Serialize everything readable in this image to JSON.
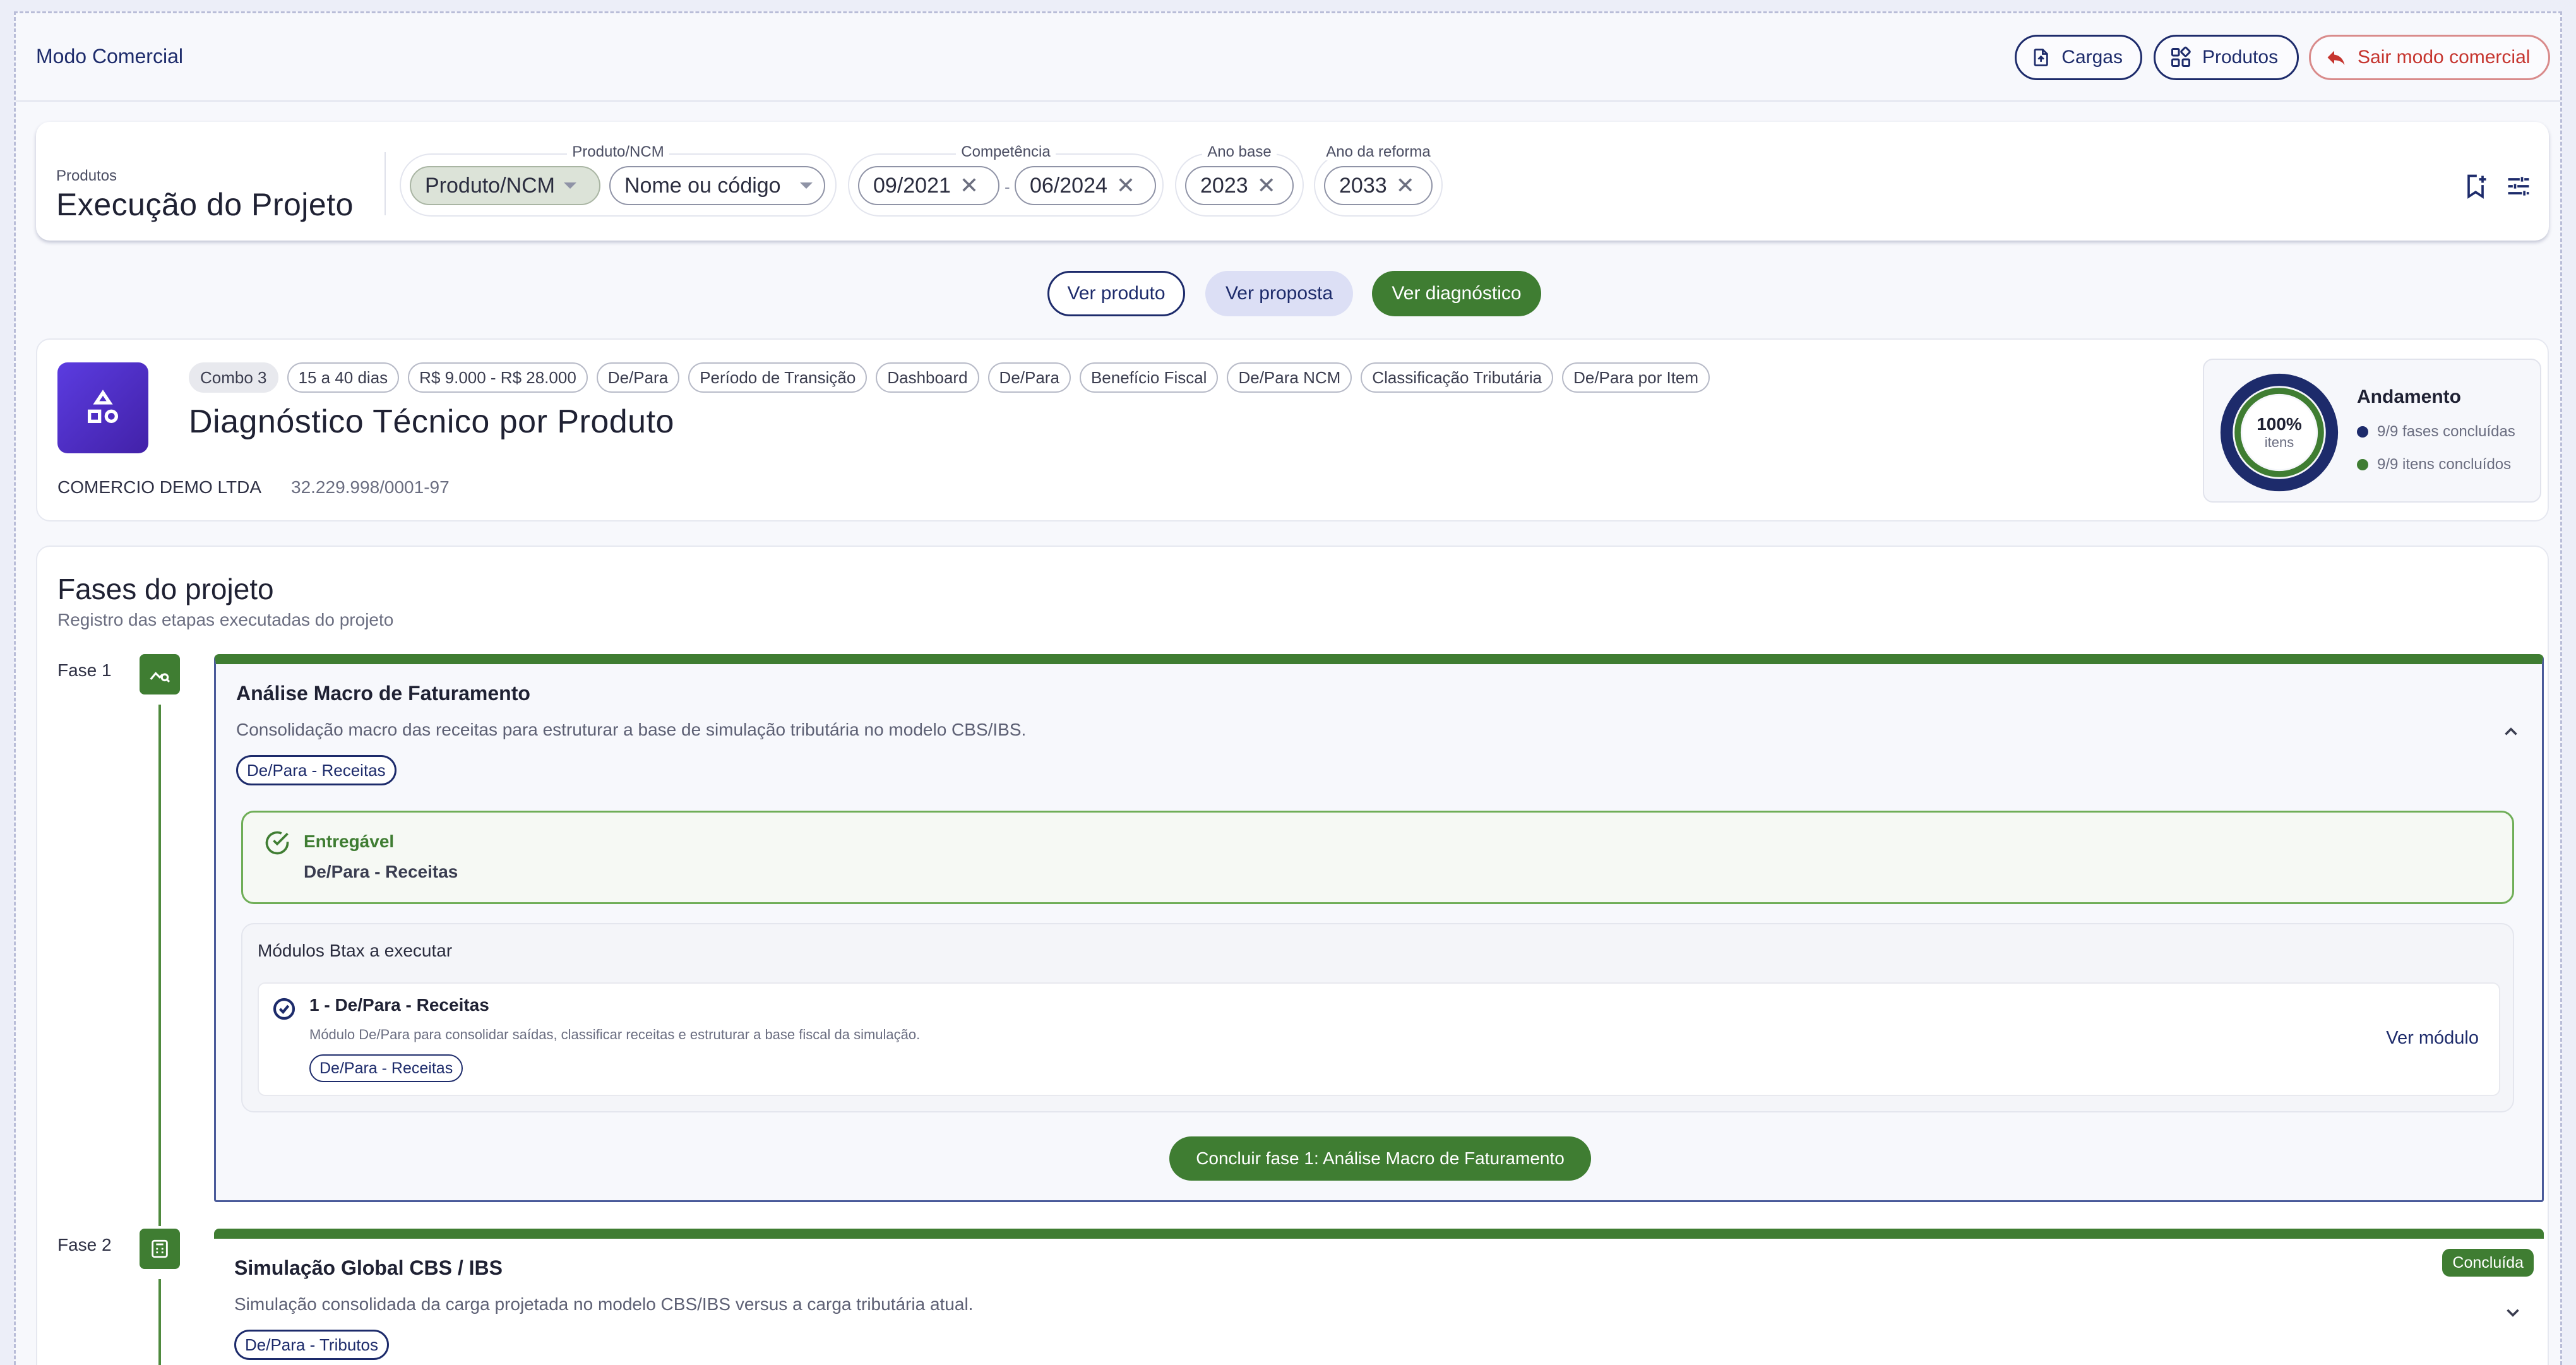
{
  "app": {
    "title": "Modo Comercial"
  },
  "topbar": {
    "cargas_label": "Cargas",
    "produtos_label": "Produtos",
    "exit_label": "Sair modo comercial"
  },
  "filters": {
    "breadcrumb": "Produtos",
    "title": "Execução do Projeto",
    "produto_group_label": "Produto/NCM",
    "produto_select": "Produto/NCM",
    "search_placeholder": "Nome ou código",
    "competencia_label": "Competência",
    "competencia_start": "09/2021",
    "competencia_end": "06/2024",
    "ano_base_label": "Ano base",
    "ano_base": "2023",
    "ano_reforma_label": "Ano da reforma",
    "ano_reforma": "2033",
    "clear_symbol": "✕",
    "separator": "-"
  },
  "view_buttons": {
    "produto": "Ver produto",
    "proposta": "Ver proposta",
    "diagnostico": "Ver diagnóstico"
  },
  "product": {
    "tags": [
      "Combo 3",
      "15 a 40 dias",
      "R$ 9.000 - R$ 28.000",
      "De/Para",
      "Período de Transição",
      "Dashboard",
      "De/Para",
      "Benefício Fiscal",
      "De/Para NCM",
      "Classificação Tributária",
      "De/Para por Item"
    ],
    "title": "Diagnóstico Técnico por Produto",
    "company": "COMERCIO DEMO LTDA",
    "cnpj": "32.229.998/0001-97",
    "progress": {
      "percent_label": "100%",
      "percent_value": 100,
      "unit": "itens",
      "title": "Andamento",
      "phases_done": "9/9 fases concluídas",
      "items_done": "9/9 itens concluídos",
      "phases_color": "#1d2b6b",
      "items_color": "#3f7d32"
    }
  },
  "phases": {
    "title": "Fases do projeto",
    "subtitle": "Registro das etapas executadas do projeto",
    "list": [
      {
        "label": "Fase 1",
        "title": "Análise Macro de Faturamento",
        "description": "Consolidação macro das receitas para estruturar a base de simulação tributária no modelo CBS/IBS.",
        "tag": "De/Para - Receitas",
        "deliverable_label": "Entregável",
        "deliverable_value": "De/Para - Receitas",
        "modules_title": "Módulos Btax a executar",
        "module": {
          "title": "1 - De/Para - Receitas",
          "description": "Módulo De/Para para consolidar saídas, classificar receitas e estruturar a base fiscal da simulação.",
          "tag": "De/Para - Receitas",
          "link": "Ver módulo"
        },
        "conclude_label": "Concluir fase 1: Análise Macro de Faturamento"
      },
      {
        "label": "Fase 2",
        "title": "Simulação Global CBS / IBS",
        "description": "Simulação consolidada da carga projetada no modelo CBS/IBS versus a carga tributária atual.",
        "tag": "De/Para - Tributos",
        "status": "Concluída"
      }
    ]
  },
  "colors": {
    "brand_navy": "#1d2b6b",
    "success_green": "#3f7d32",
    "danger_red": "#c6352f",
    "product_icon": "#5b3ce0"
  }
}
